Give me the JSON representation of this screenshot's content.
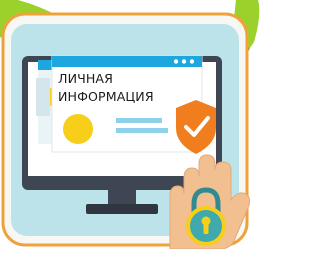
{
  "card": {
    "title_lines": [
      "ЛИЧНАЯ",
      "ИНФОРМАЦИЯ"
    ]
  },
  "colors": {
    "frame_orange": "#f0a23a",
    "panel_blue": "#bde3ea",
    "accent_green": "#9ad12a",
    "monitor_dark": "#3d4652",
    "screen_blue": "#1da7de",
    "shield_orange": "#f07d1e",
    "dot_yellow": "#f7cf1a",
    "hand_peach": "#f2bf91",
    "lock_teal": "#3fa9ad"
  },
  "icons": [
    "shield-check-icon",
    "padlock-icon",
    "hand-icon",
    "monitor-icon"
  ]
}
